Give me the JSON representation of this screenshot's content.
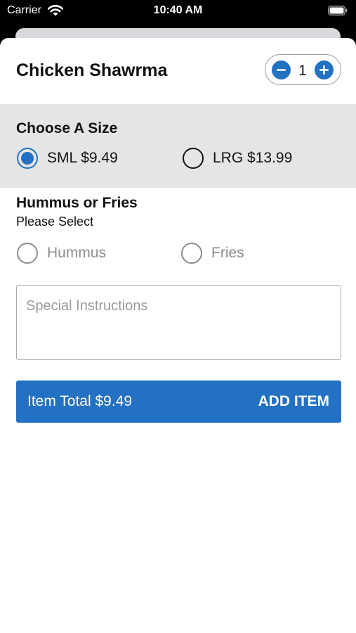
{
  "status_bar": {
    "carrier": "Carrier",
    "time": "10:40 AM",
    "wifi_icon": "wifi-icon",
    "battery_icon": "battery-icon"
  },
  "item": {
    "title": "Chicken Shawrma",
    "quantity": "1",
    "minus_icon": "minus-circle-icon",
    "plus_icon": "plus-circle-icon"
  },
  "size_section": {
    "heading": "Choose A Size",
    "options": [
      {
        "label": "SML $9.49",
        "selected": true
      },
      {
        "label": "LRG $13.99",
        "selected": false
      }
    ]
  },
  "side_section": {
    "heading": "Hummus or Fries",
    "subheading": "Please Select",
    "options": [
      {
        "label": "Hummus",
        "selected": false
      },
      {
        "label": "Fries",
        "selected": false
      }
    ]
  },
  "instructions": {
    "placeholder": "Special Instructions",
    "value": ""
  },
  "add_button": {
    "total_label": "Item Total $9.49",
    "action_label": "ADD ITEM"
  },
  "colors": {
    "accent": "#2271c3",
    "section_background": "#e4e5e6",
    "muted_text": "#8c8c8c"
  }
}
